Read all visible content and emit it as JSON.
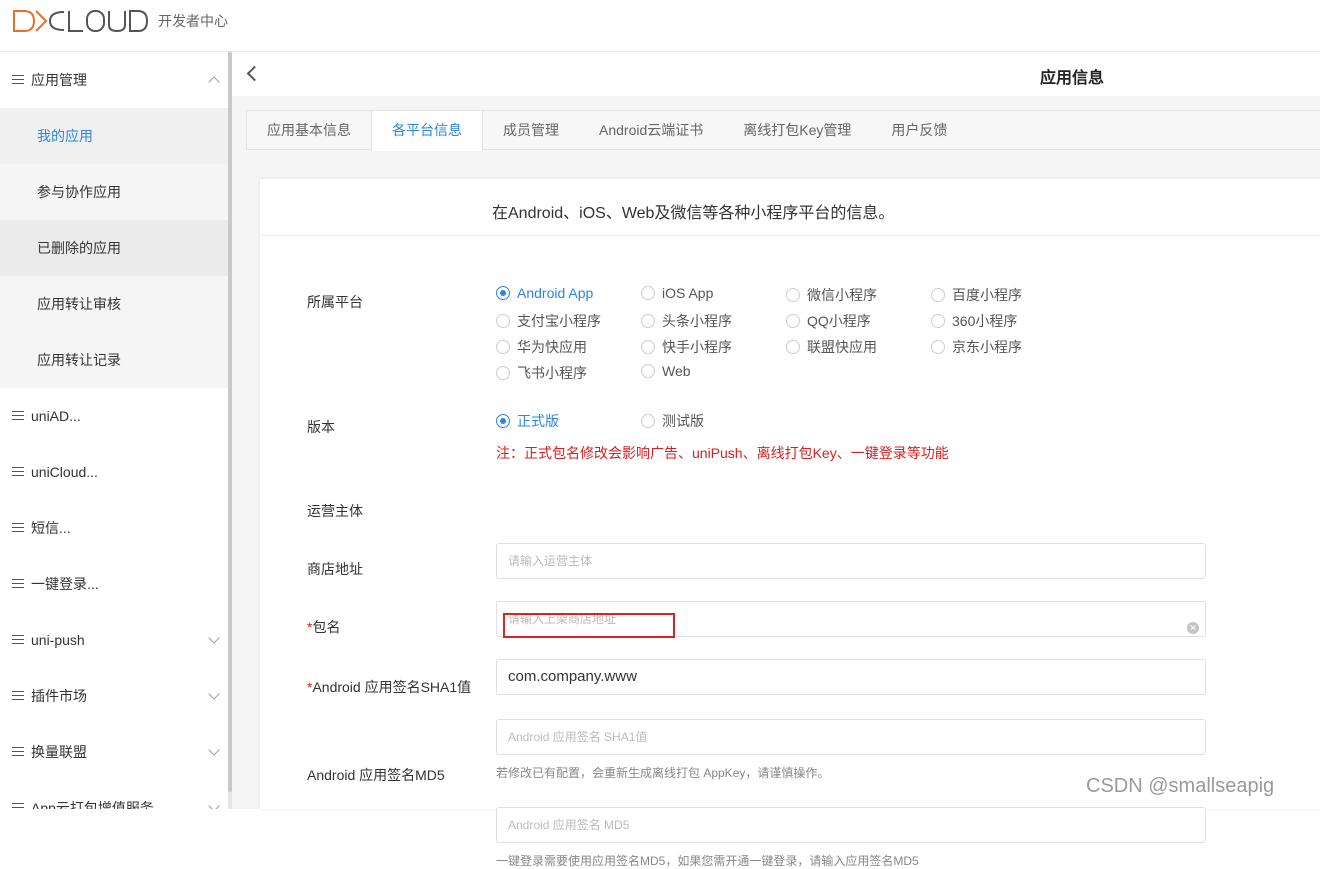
{
  "brand": {
    "logo_text": "DCLOUD",
    "subtitle": "开发者中心",
    "accent": "#e8702a"
  },
  "sidebar": {
    "groups": [
      {
        "label": "应用管理",
        "expanded": true,
        "sub": [
          "我的应用",
          "参与协作应用",
          "已删除的应用",
          "应用转让审核",
          "应用转让记录"
        ]
      },
      {
        "label": "uniAD..."
      },
      {
        "label": "uniCloud..."
      },
      {
        "label": "短信..."
      },
      {
        "label": "一键登录..."
      },
      {
        "label": "uni-push"
      },
      {
        "label": "插件市场"
      },
      {
        "label": "换量联盟"
      },
      {
        "label": "App云打包增值服务"
      }
    ]
  },
  "header": {
    "title": "应用信息"
  },
  "tabs": [
    "应用基本信息",
    "各平台信息",
    "成员管理",
    "Android云端证书",
    "离线打包Key管理",
    "用户反馈"
  ],
  "card": {
    "description": "在Android、iOS、Web及微信等各种小程序平台的信息。"
  },
  "form": {
    "platform_label": "所属平台",
    "platforms": [
      "Android App",
      "iOS App",
      "微信小程序",
      "百度小程序",
      "支付宝小程序",
      "头条小程序",
      "QQ小程序",
      "360小程序",
      "华为快应用",
      "快手小程序",
      "联盟快应用",
      "京东小程序",
      "飞书小程序",
      "Web"
    ],
    "selected_platform": "Android App",
    "version_label": "版本",
    "versions": [
      "正式版",
      "测试版"
    ],
    "selected_version": "正式版",
    "note": "注：正式包名修改会影响广告、uniPush、离线打包Key、一键登录等功能",
    "operator_label": "运营主体",
    "operator_placeholder": "请输入运营主体",
    "store_label": "商店地址",
    "store_placeholder": "请输入上架商店地址",
    "package_required": "*",
    "package_label": "包名",
    "package_value": "com.company.www",
    "sha1_required": "*",
    "sha1_label": "Android 应用签名SHA1值",
    "sha1_placeholder": "Android 应用签名 SHA1值",
    "sha1_hint": "若修改已有配置，会重新生成离线打包 AppKey，请谨慎操作。",
    "md5_label": "Android 应用签名MD5",
    "md5_placeholder": "Android 应用签名  MD5",
    "md5_hint": "一键登录需要使用应用签名MD5，如果您需开通一键登录，请输入应用签名MD5"
  },
  "watermark": "CSDN @smallseapig"
}
